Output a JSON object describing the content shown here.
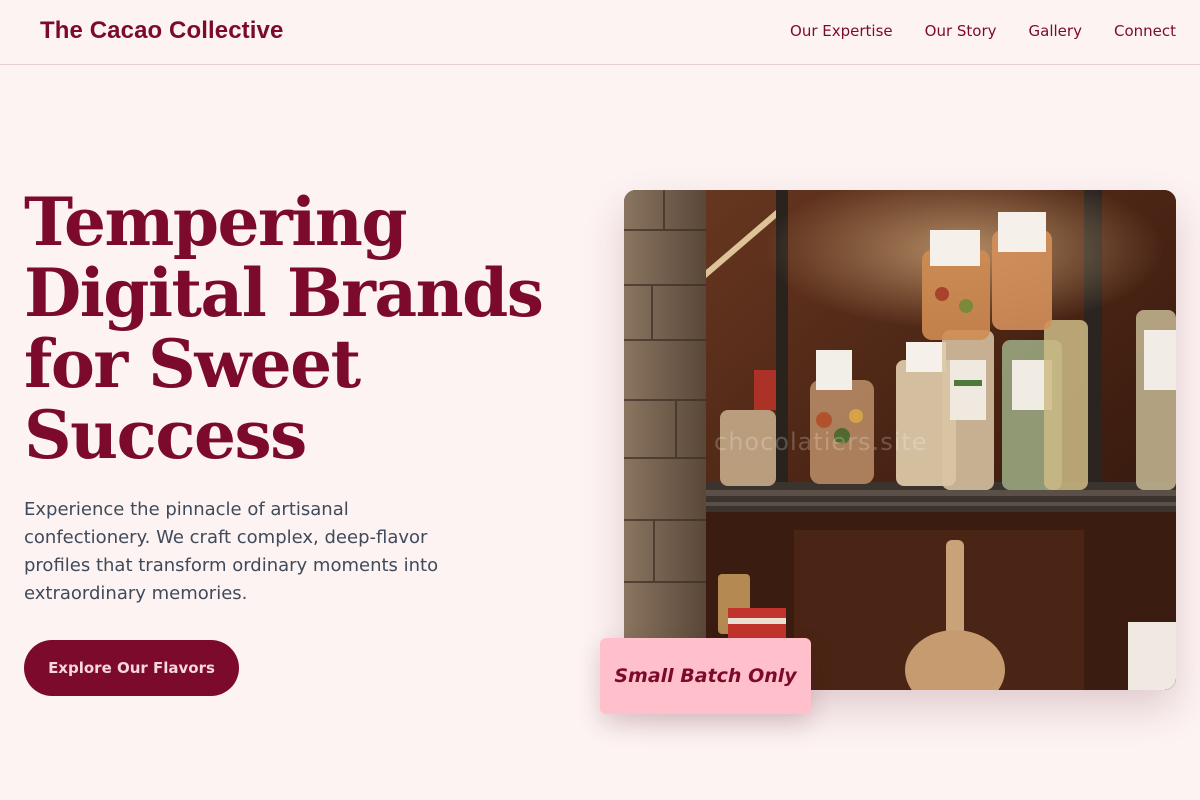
{
  "header": {
    "brand": "The Cacao Collective",
    "nav": [
      {
        "label": "Our Expertise"
      },
      {
        "label": "Our Story"
      },
      {
        "label": "Gallery"
      },
      {
        "label": "Connect"
      }
    ]
  },
  "hero": {
    "headline": "Tempering Digital Brands for Sweet Success",
    "description": "Experience the pinnacle of artisanal confectionery. We craft complex, deep-flavor profiles that transform ordinary moments into extraordinary memories.",
    "cta_label": "Explore Our Flavors",
    "badge": "Small Batch Only",
    "image_watermark": "chocolatiers.site"
  },
  "colors": {
    "background": "#fdf3f3",
    "primary": "#7c0a2c",
    "badge": "#ffc0cb",
    "body_text": "#3f4a5a"
  }
}
